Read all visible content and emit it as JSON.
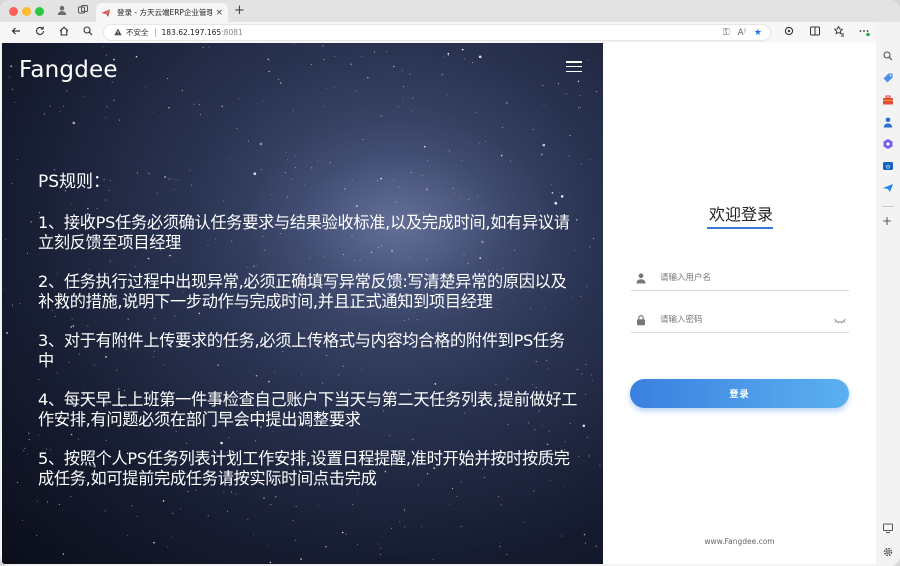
{
  "browser": {
    "tab_title": "登录 - 方天云端ERP企业管理软件",
    "tab_close": "×",
    "new_tab": "+",
    "security_label": "不安全",
    "url_host": "183.62.197.165",
    "url_port": ":8081"
  },
  "header": {
    "logo": "Fangdee"
  },
  "rules": {
    "title": "PS规则：",
    "items": [
      "1、接收PS任务必须确认任务要求与结果验收标准,以及完成时间,如有异议请立刻反馈至项目经理",
      "2、任务执行过程中出现异常,必须正确填写异常反馈:写清楚异常的原因以及补救的措施,说明下一步动作与完成时间,并且正式通知到项目经理",
      "3、对于有附件上传要求的任务,必须上传格式与内容均合格的附件到PS任务中",
      "4、每天早上上班第一件事检查自己账户下当天与第二天任务列表,提前做好工作安排,有问题必须在部门早会中提出调整要求",
      "5、按照个人PS任务列表计划工作安排,设置日程提醒,准时开始并按时按质完成任务,如可提前完成任务请按实际时间点击完成"
    ]
  },
  "login": {
    "title": "欢迎登录",
    "username_placeholder": "请输入用户名",
    "password_placeholder": "请输入密码",
    "submit_label": "登录",
    "footer": "www.Fangdee.com",
    "accent_color": "#3a78d8"
  }
}
